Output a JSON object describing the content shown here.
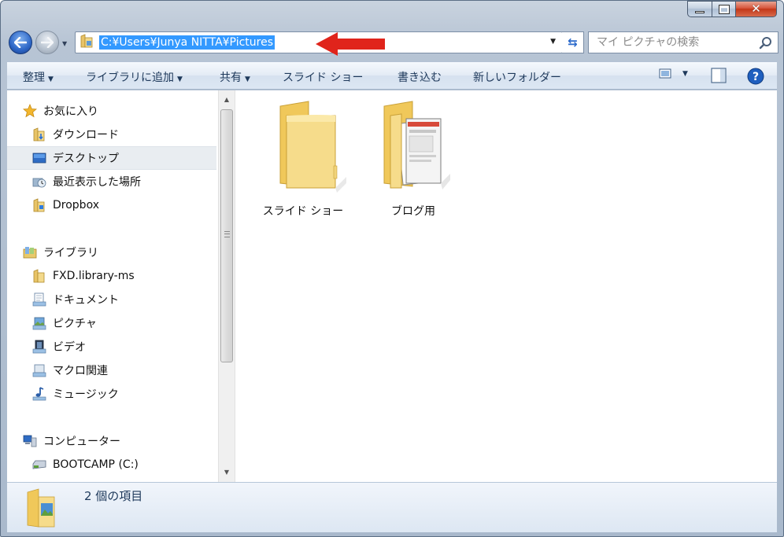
{
  "window": {
    "caption_buttons": {
      "minimize": "minimize",
      "maximize": "maximize",
      "close": "✕"
    }
  },
  "address_bar": {
    "path": "C:¥Users¥Junya NITTA¥Pictures"
  },
  "search": {
    "placeholder": "マイ ピクチャの検索"
  },
  "toolbar": {
    "organize": "整理",
    "add_to_library": "ライブラリに追加",
    "share": "共有",
    "slideshow": "スライド ショー",
    "burn": "書き込む",
    "new_folder": "新しいフォルダー"
  },
  "nav_pane": {
    "favorites": {
      "label": "お気に入り",
      "items": [
        {
          "label": "ダウンロード",
          "icon": "download-folder-icon"
        },
        {
          "label": "デスクトップ",
          "icon": "desktop-icon",
          "selected": true
        },
        {
          "label": "最近表示した場所",
          "icon": "recent-places-icon"
        },
        {
          "label": "Dropbox",
          "icon": "dropbox-folder-icon"
        }
      ]
    },
    "libraries": {
      "label": "ライブラリ",
      "items": [
        {
          "label": "FXD.library-ms",
          "icon": "folder-icon"
        },
        {
          "label": "ドキュメント",
          "icon": "documents-library-icon"
        },
        {
          "label": "ピクチャ",
          "icon": "pictures-library-icon"
        },
        {
          "label": "ビデオ",
          "icon": "videos-library-icon"
        },
        {
          "label": "マクロ関連",
          "icon": "library-icon"
        },
        {
          "label": "ミュージック",
          "icon": "music-library-icon"
        }
      ]
    },
    "computer": {
      "label": "コンピューター",
      "items": [
        {
          "label": "BOOTCAMP (C:)",
          "icon": "drive-icon"
        }
      ]
    }
  },
  "files": [
    {
      "name": "スライド ショー",
      "icon": "folder-icon"
    },
    {
      "name": "ブログ用",
      "icon": "folder-with-images-icon"
    }
  ],
  "status": {
    "item_count": "2 個の項目"
  },
  "colors": {
    "selection": "#3399ff",
    "annotation_arrow": "#e0241b",
    "toolbar_text": "#1e395b"
  }
}
